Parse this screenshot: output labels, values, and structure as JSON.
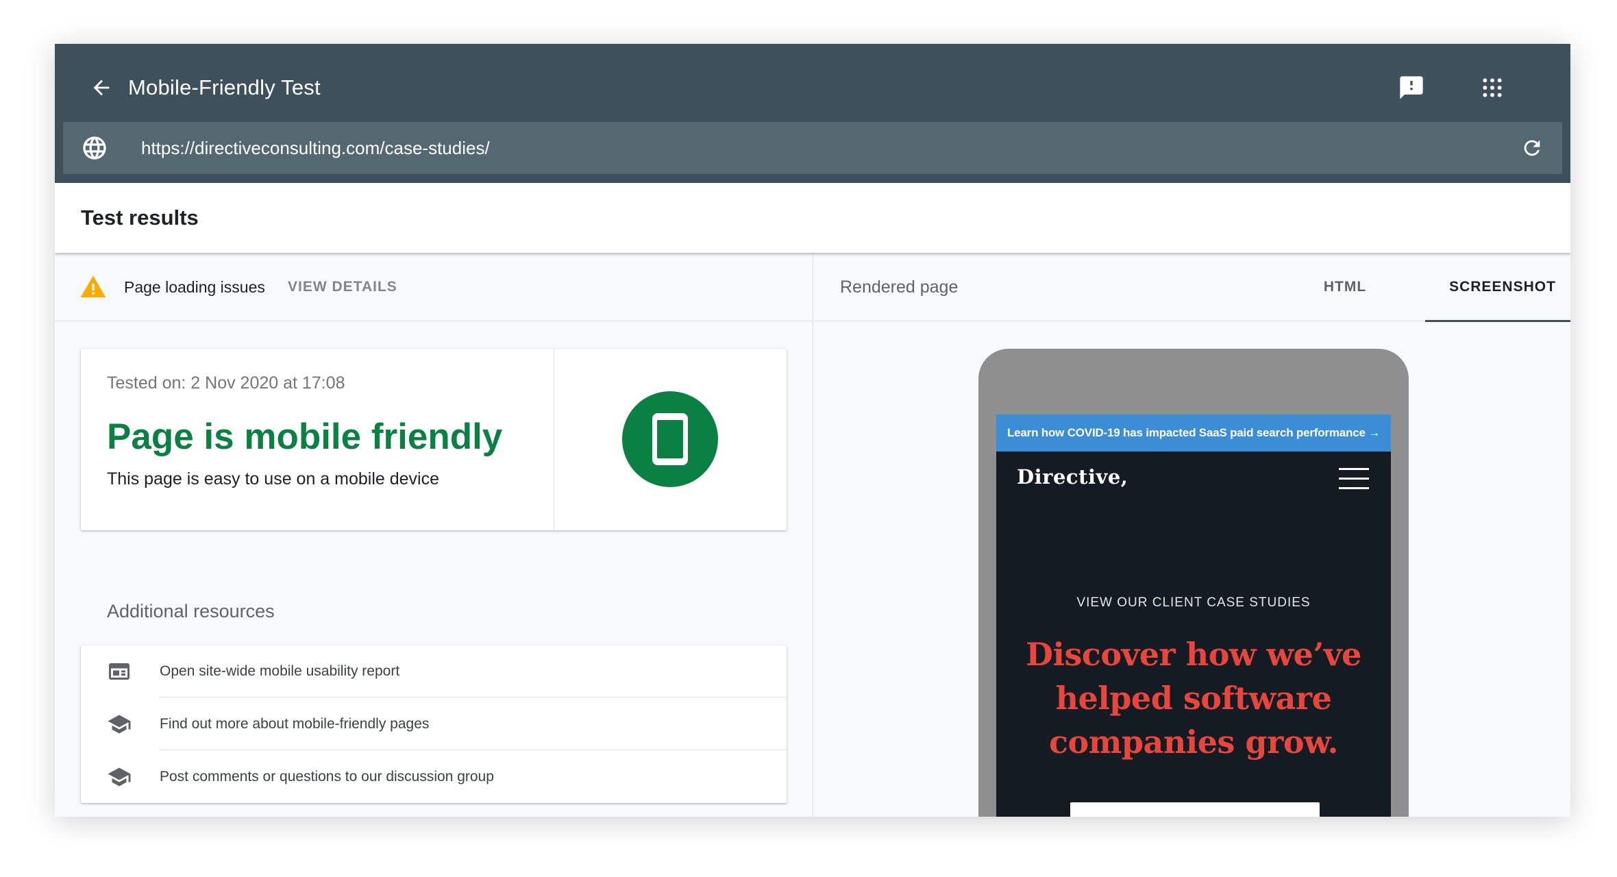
{
  "app": {
    "title": "Mobile-Friendly Test",
    "url": "https://directiveconsulting.com/case-studies/",
    "icons": {
      "back": "arrow-left-icon",
      "feedback": "feedback-icon",
      "apps": "apps-grid-icon",
      "globe": "globe-icon",
      "reload": "reload-icon"
    }
  },
  "results": {
    "header": "Test results",
    "issues": {
      "text": "Page loading issues",
      "action": "VIEW DETAILS"
    },
    "card": {
      "tested_on": "Tested on: 2 Nov 2020 at 17:08",
      "verdict": "Page is mobile friendly",
      "description": "This page is easy to use on a mobile device"
    },
    "additional_title": "Additional resources",
    "resources": [
      {
        "label": "Open site-wide mobile usability report",
        "icon": "report-icon"
      },
      {
        "label": "Find out more about mobile-friendly pages",
        "icon": "school-icon"
      },
      {
        "label": "Post comments or questions to our discussion group",
        "icon": "school-icon"
      }
    ]
  },
  "rendered": {
    "title": "Rendered page",
    "tabs": {
      "html": "HTML",
      "screenshot": "SCREENSHOT"
    },
    "active_tab": "SCREENSHOT",
    "screenshot": {
      "banner": "Learn how COVID-19 has impacted SaaS paid search performance →",
      "logo": "Directive,",
      "eyebrow": "VIEW OUR CLIENT CASE STUDIES",
      "headline": "Discover how we’ve helped software companies grow."
    }
  },
  "colors": {
    "appbar": "#3d505b",
    "urlbar": "#546872",
    "success": "#0b8043",
    "warning": "#f9ab00",
    "banner": "#3b8ed5",
    "headline": "#e8463c",
    "phone_bg": "#141b23"
  }
}
